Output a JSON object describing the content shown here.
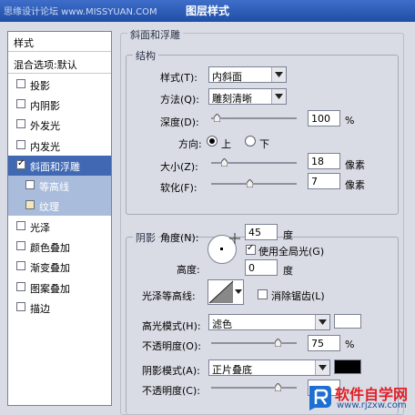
{
  "titlebar": {
    "watermark": "思缘设计论坛 www.MISSYUAN.COM",
    "title": "图层样式"
  },
  "left_panel": {
    "header": "样式",
    "blend_options": "混合选项:默认",
    "items": [
      {
        "label": "投影",
        "checked": false
      },
      {
        "label": "内阴影",
        "checked": false
      },
      {
        "label": "外发光",
        "checked": false
      },
      {
        "label": "内发光",
        "checked": false
      },
      {
        "label": "斜面和浮雕",
        "checked": true,
        "selected": true
      },
      {
        "label": "等高线",
        "checked": false,
        "sub": true
      },
      {
        "label": "纹理",
        "checked": false,
        "sub": true
      },
      {
        "label": "光泽",
        "checked": false
      },
      {
        "label": "颜色叠加",
        "checked": false
      },
      {
        "label": "渐变叠加",
        "checked": false
      },
      {
        "label": "图案叠加",
        "checked": false
      },
      {
        "label": "描边",
        "checked": false
      }
    ]
  },
  "bevel": {
    "legend": "斜面和浮雕",
    "structure": {
      "legend": "结构",
      "style_label": "样式(T):",
      "style_value": "内斜面",
      "technique_label": "方法(Q):",
      "technique_value": "雕刻清晰",
      "depth_label": "深度(D):",
      "depth_value": "100",
      "depth_unit": "%",
      "direction_label": "方向:",
      "direction_up": "上",
      "direction_down": "下",
      "size_label": "大小(Z):",
      "size_value": "18",
      "size_unit": "像素",
      "soften_label": "软化(F):",
      "soften_value": "7",
      "soften_unit": "像素"
    },
    "shading": {
      "legend": "阴影",
      "angle_label": "角度(N):",
      "angle_value": "45",
      "angle_unit": "度",
      "global_light_label": "使用全局光(G)",
      "altitude_label": "高度:",
      "altitude_value": "0",
      "altitude_unit": "度",
      "gloss_label": "光泽等高线:",
      "antialias_label": "消除锯齿(L)",
      "highlight_mode_label": "高光模式(H):",
      "highlight_mode_value": "滤色",
      "highlight_opacity_label": "不透明度(O):",
      "highlight_opacity_value": "75",
      "highlight_opacity_unit": "%",
      "shadow_mode_label": "阴影模式(A):",
      "shadow_mode_value": "正片叠底",
      "shadow_opacity_label": "不透明度(C):"
    }
  },
  "watermark": {
    "brand": "软件自学网",
    "url": "www.rjzxw.com"
  },
  "colors": {
    "highlight": "#ffffff",
    "shadow": "#000000",
    "selected": "#4169b3"
  }
}
